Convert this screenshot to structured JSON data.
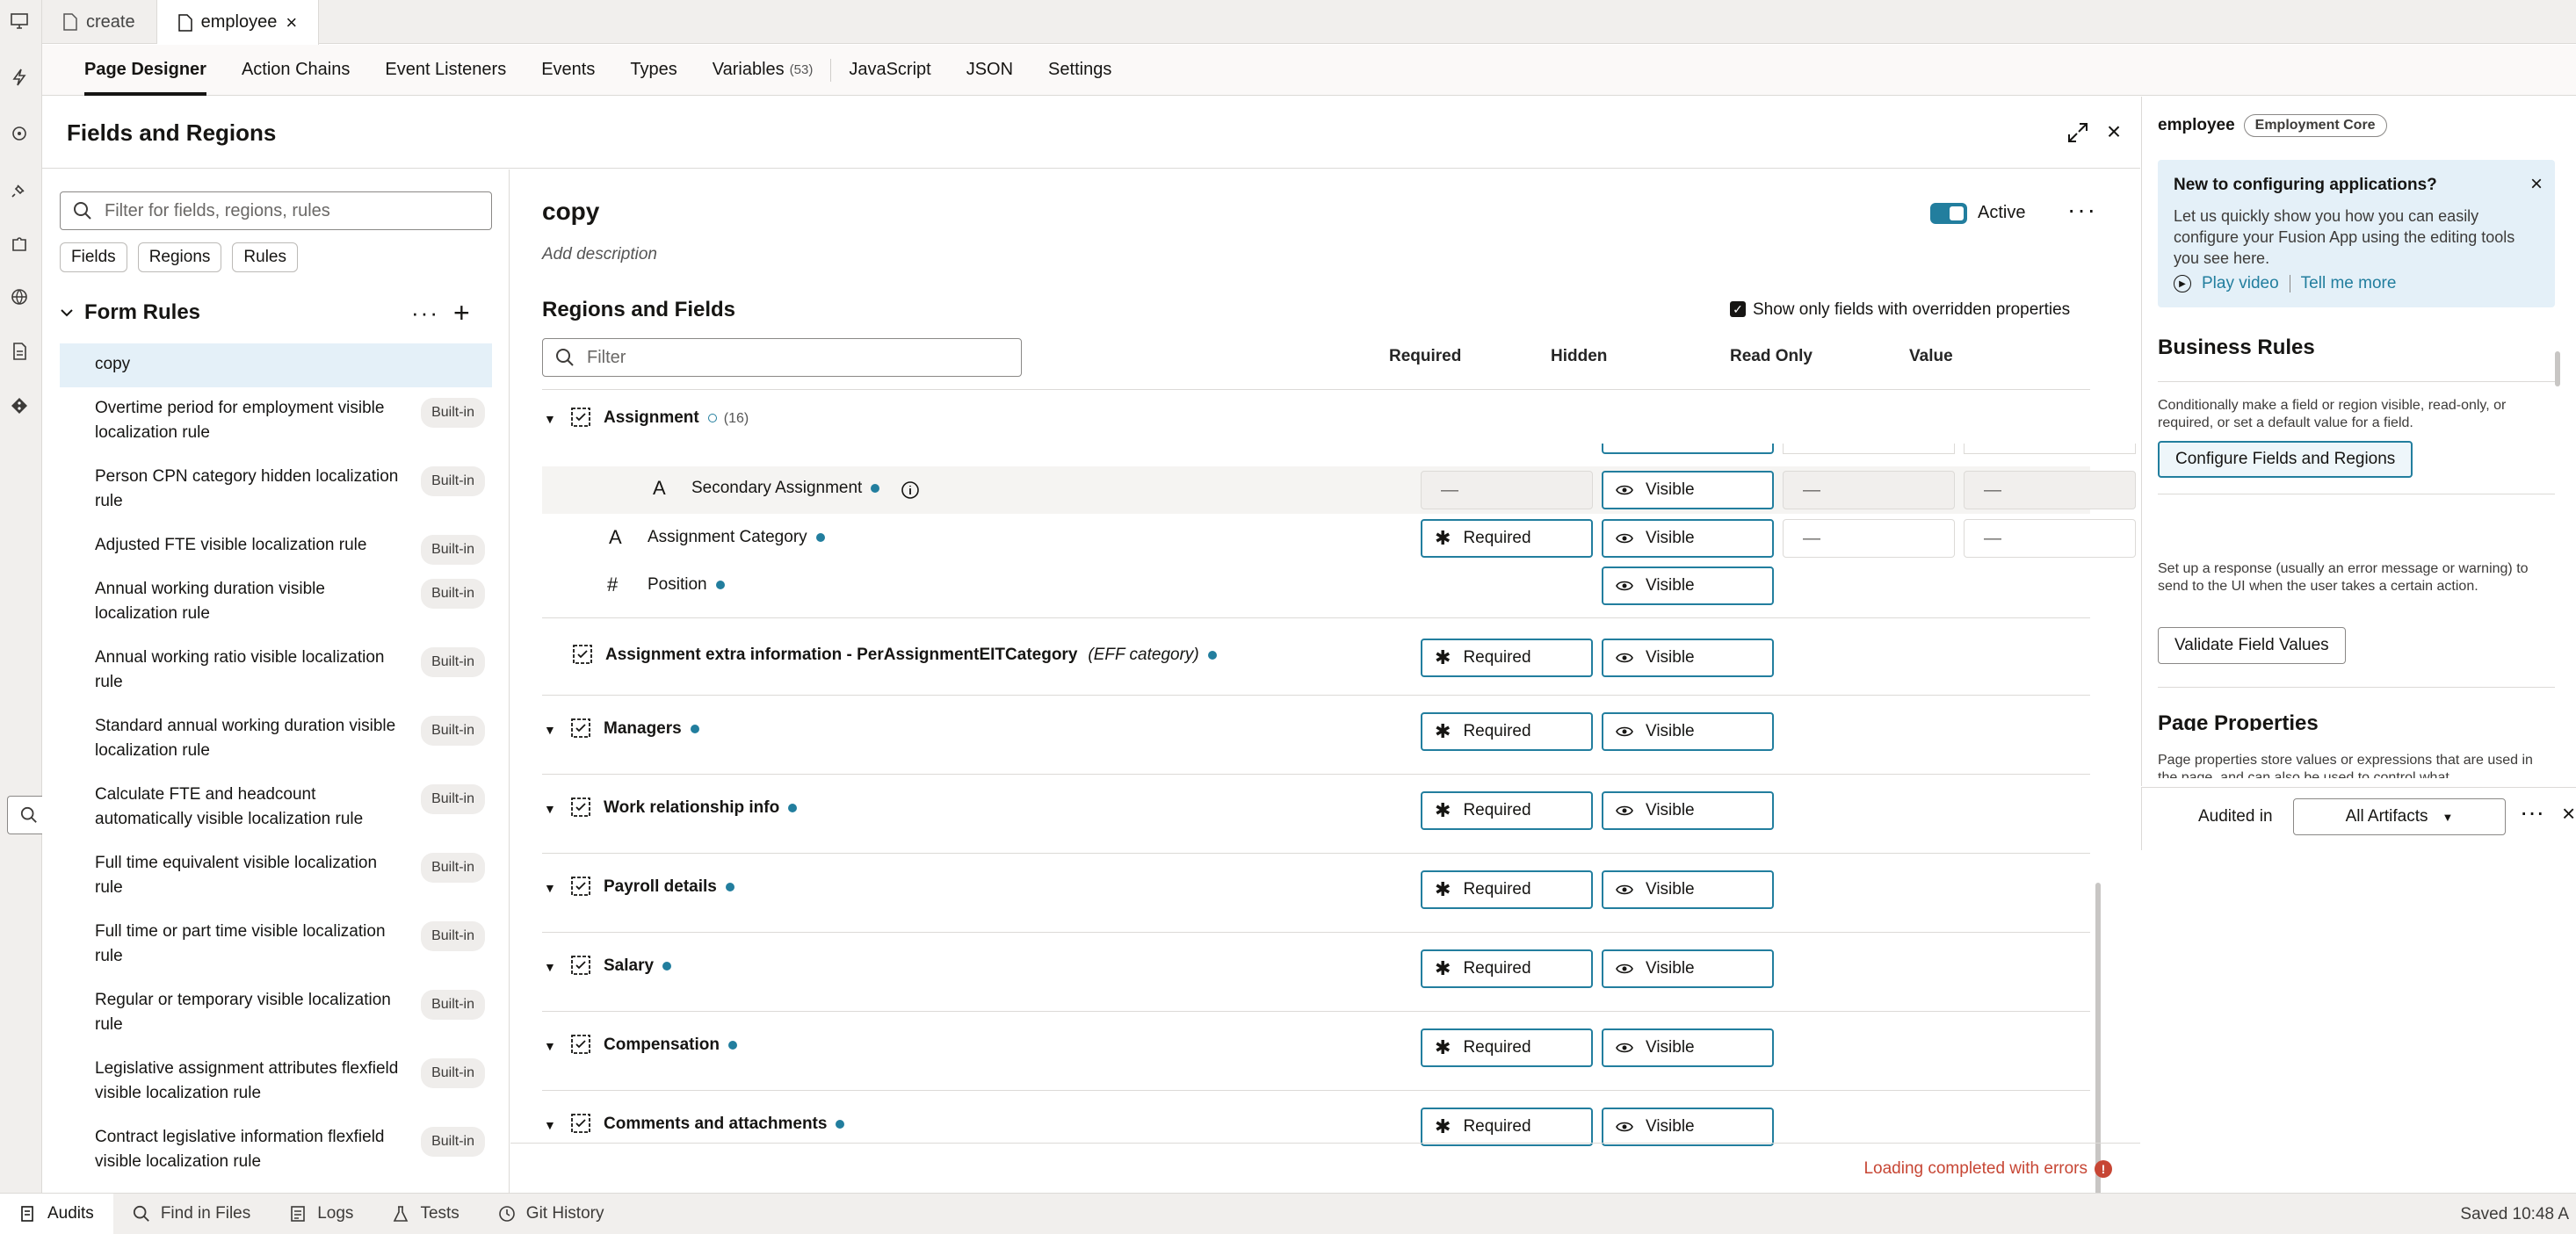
{
  "editor_tabs": [
    {
      "label": "create",
      "icon": "file-icon",
      "active": false
    },
    {
      "label": "employee",
      "icon": "file-icon",
      "active": true,
      "close": "×"
    }
  ],
  "designer_tabs": [
    {
      "label": "Page Designer",
      "active": true
    },
    {
      "label": "Action Chains"
    },
    {
      "label": "Event Listeners"
    },
    {
      "label": "Events"
    },
    {
      "label": "Types"
    },
    {
      "label": "Variables",
      "count": "(53)"
    },
    {
      "label": "JavaScript"
    },
    {
      "label": "JSON"
    },
    {
      "label": "Settings"
    }
  ],
  "panel": {
    "title": "Fields and Regions"
  },
  "left": {
    "search_placeholder": "Filter for fields, regions, rules",
    "chips": [
      "Fields",
      "Regions",
      "Rules"
    ],
    "section_title": "Form Rules",
    "rules": [
      {
        "label": "copy",
        "badge": "",
        "selected": true
      },
      {
        "label": "Overtime period for employment visible localization rule",
        "badge": "Built-in"
      },
      {
        "label": "Person CPN category hidden localization rule",
        "badge": "Built-in"
      },
      {
        "label": "Adjusted FTE visible localization rule",
        "badge": "Built-in"
      },
      {
        "label": "Annual working duration visible localization rule",
        "badge": "Built-in"
      },
      {
        "label": "Annual working ratio visible localization rule",
        "badge": "Built-in"
      },
      {
        "label": "Standard annual working duration visible localization rule",
        "badge": "Built-in"
      },
      {
        "label": "Calculate FTE and headcount automatically visible localization rule",
        "badge": "Built-in"
      },
      {
        "label": "Full time equivalent visible localization rule",
        "badge": "Built-in"
      },
      {
        "label": "Full time or part time visible localization rule",
        "badge": "Built-in"
      },
      {
        "label": "Regular or temporary visible localization rule",
        "badge": "Built-in"
      },
      {
        "label": "Legislative assignment attributes flexfield visible localization rule",
        "badge": "Built-in"
      },
      {
        "label": "Contract legislative information flexfield visible localization rule",
        "badge": "Built-in"
      }
    ]
  },
  "center": {
    "title": "copy",
    "description_placeholder": "Add description",
    "active_label": "Active",
    "section_title": "Regions and Fields",
    "checkbox_label": "Show only fields with overridden properties",
    "filter_placeholder": "Filter",
    "columns": [
      "Required",
      "Hidden",
      "Read Only",
      "Value"
    ],
    "assignment": {
      "name": "Assignment",
      "count": "(16)"
    },
    "fields": [
      {
        "name": "Secondary Assignment",
        "hidden": "Visible",
        "read_only": "—",
        "value": "—",
        "required": "—"
      },
      {
        "name": "Assignment Category",
        "required": "Required",
        "hidden": "Visible",
        "read_only": "—",
        "value": "—"
      },
      {
        "name": "Position",
        "hidden": "Visible"
      }
    ],
    "eff_region": {
      "name": "Assignment extra information - PerAssignmentEITCategory",
      "tag": "(EFF category)",
      "required": "Required",
      "hidden": "Visible"
    },
    "regions": [
      {
        "name": "Managers",
        "required": "Required",
        "hidden": "Visible"
      },
      {
        "name": "Work relationship info",
        "required": "Required",
        "hidden": "Visible"
      },
      {
        "name": "Payroll details",
        "required": "Required",
        "hidden": "Visible"
      },
      {
        "name": "Salary",
        "required": "Required",
        "hidden": "Visible"
      },
      {
        "name": "Compensation",
        "required": "Required",
        "hidden": "Visible"
      },
      {
        "name": "Comments and attachments",
        "required": "Required",
        "hidden": "Visible"
      }
    ],
    "status": "Loading completed with errors"
  },
  "right": {
    "page": "employee",
    "pill": "Employment Core",
    "promo_title": "New to configuring applications?",
    "promo_text": "Let us quickly show you how you can easily configure your Fusion App using the editing tools you see here.",
    "play_video": "Play video",
    "tell_more": "Tell me more",
    "business_rules_title": "Business Rules",
    "br_desc1": "Conditionally make a field or region visible, read-only, or required, or set a default value for a field.",
    "br_button1": "Configure Fields and Regions",
    "br_desc2": "Set up a response (usually an error message or warning) to send to the UI when the user takes a certain action.",
    "br_button2": "Validate Field Values",
    "page_props_title": "Page Properties",
    "page_props_desc": "Page properties store values or expressions that are used in the page, and can also be used to control what"
  },
  "audit": {
    "label": "Audited in",
    "select": "All Artifacts"
  },
  "bottom": {
    "items": [
      {
        "label": "Audits",
        "active": true
      },
      {
        "label": "Find in Files"
      },
      {
        "label": "Logs"
      },
      {
        "label": "Tests"
      },
      {
        "label": "Git History"
      }
    ],
    "saved": "Saved 10:48 A"
  },
  "colors": {
    "accent": "#227e9e",
    "error": "#c74634",
    "selected_bg": "#e4f0f8"
  }
}
